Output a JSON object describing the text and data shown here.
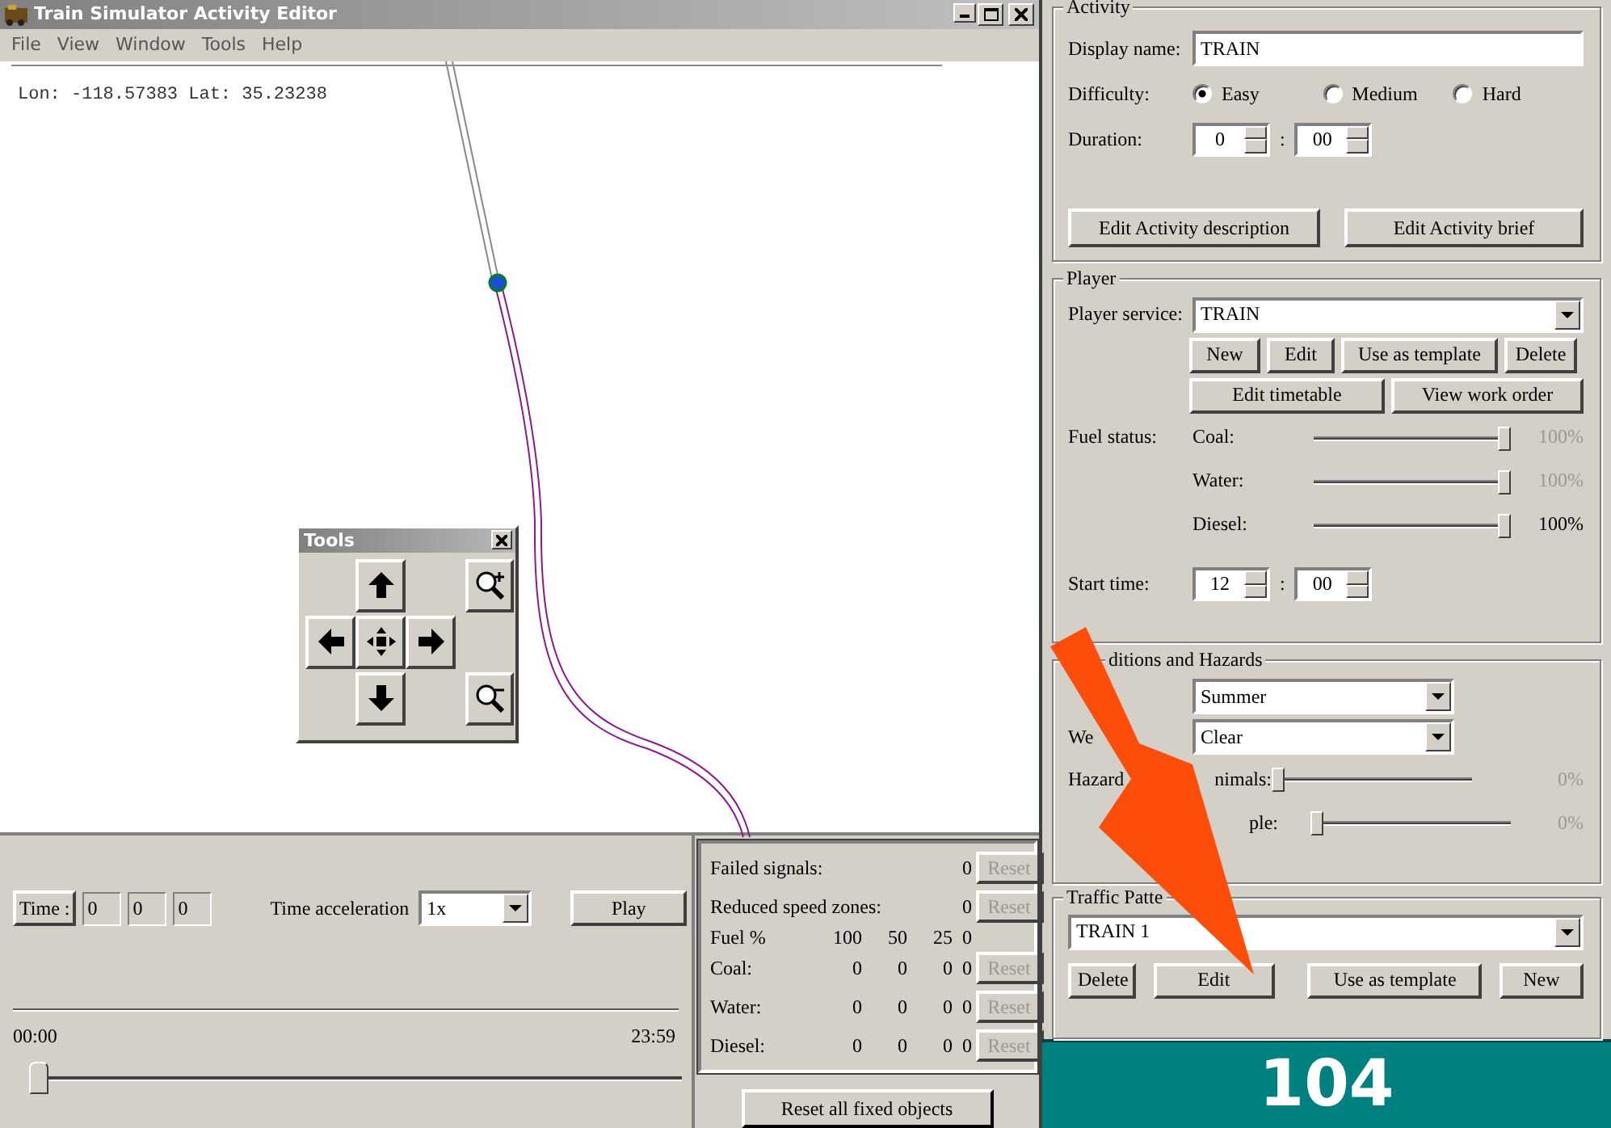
{
  "window": {
    "title": "Train Simulator Activity Editor"
  },
  "menu": [
    "File",
    "View",
    "Window",
    "Tools",
    "Help"
  ],
  "map": {
    "coordinates": "Lon: -118.57383 Lat: 35.23238"
  },
  "tools_palette": {
    "title": "Tools"
  },
  "playback": {
    "time_label": "Time :",
    "time_fields": [
      "0",
      "0",
      "0"
    ],
    "acceleration_label": "Time acceleration",
    "acceleration": "1x",
    "play": "Play",
    "start": "00:00",
    "end": "23:59",
    "level": 0
  },
  "fixed_objects": {
    "rows": [
      {
        "label": "Failed signals:",
        "values": [
          "0"
        ],
        "reset": {
          "label": "Reset",
          "disabled": true
        }
      },
      {
        "label": "Reduced speed zones:",
        "values": [
          "0"
        ],
        "reset": {
          "label": "Reset",
          "disabled": true
        }
      },
      {
        "label": "Fuel %",
        "values": [
          "100",
          "50",
          "25",
          "0"
        ]
      },
      {
        "label": "Coal:",
        "values": [
          "0",
          "0",
          "0",
          "0"
        ],
        "reset": {
          "label": "Reset",
          "disabled": true
        }
      },
      {
        "label": "Water:",
        "values": [
          "0",
          "0",
          "0",
          "0"
        ],
        "reset": {
          "label": "Reset",
          "disabled": true
        }
      },
      {
        "label": "Diesel:",
        "values": [
          "0",
          "0",
          "0",
          "0"
        ],
        "reset": {
          "label": "Reset",
          "disabled": true
        }
      }
    ],
    "reset_all": "Reset all fixed objects"
  },
  "activity": {
    "title": "Activity",
    "display_name_label": "Display name:",
    "display_name": "TRAIN",
    "difficulty_label": "Difficulty:",
    "difficulty": [
      {
        "label": "Easy",
        "selected": true
      },
      {
        "label": "Medium",
        "selected": false
      },
      {
        "label": "Hard",
        "selected": false
      }
    ],
    "duration_label": "Duration:",
    "duration": {
      "hours": "0",
      "separator": ":",
      "minutes": "00"
    },
    "buttons": [
      "Edit Activity description",
      "Edit Activity brief"
    ]
  },
  "player": {
    "title": "Player",
    "service_label": "Player service:",
    "service": "TRAIN",
    "buttons": [
      "New",
      "Edit",
      "Use as template",
      "Delete"
    ],
    "buttons_2": [
      "Edit timetable",
      "View work order"
    ],
    "fuel_label": "Fuel status:",
    "fuel": [
      {
        "name": "Coal:",
        "level": 1,
        "reading": "100%",
        "disabled": true
      },
      {
        "name": "Water:",
        "level": 1,
        "reading": "100%",
        "disabled": true
      },
      {
        "name": "Diesel:",
        "level": 1,
        "reading": "100%",
        "disabled": false
      }
    ],
    "start_time_label": "Start time:",
    "start_time": {
      "hours": "12",
      "separator": ":",
      "minutes": "00"
    }
  },
  "conditions": {
    "title": "ditions and Hazards",
    "season": "Summer",
    "weather_label": "We",
    "weather": "Clear",
    "hazards_label": "Hazard",
    "hazards": [
      {
        "name": "nimals:",
        "level": 0,
        "reading": "0%",
        "disabled": true
      },
      {
        "name": "ple:",
        "level": 0,
        "reading": "0%",
        "disabled": true
      }
    ]
  },
  "traffic": {
    "title": "Traffic Patte",
    "pattern": "TRAIN 1",
    "buttons": [
      "Delete",
      "Edit",
      "Use as template",
      "New"
    ]
  },
  "page_number": "104"
}
